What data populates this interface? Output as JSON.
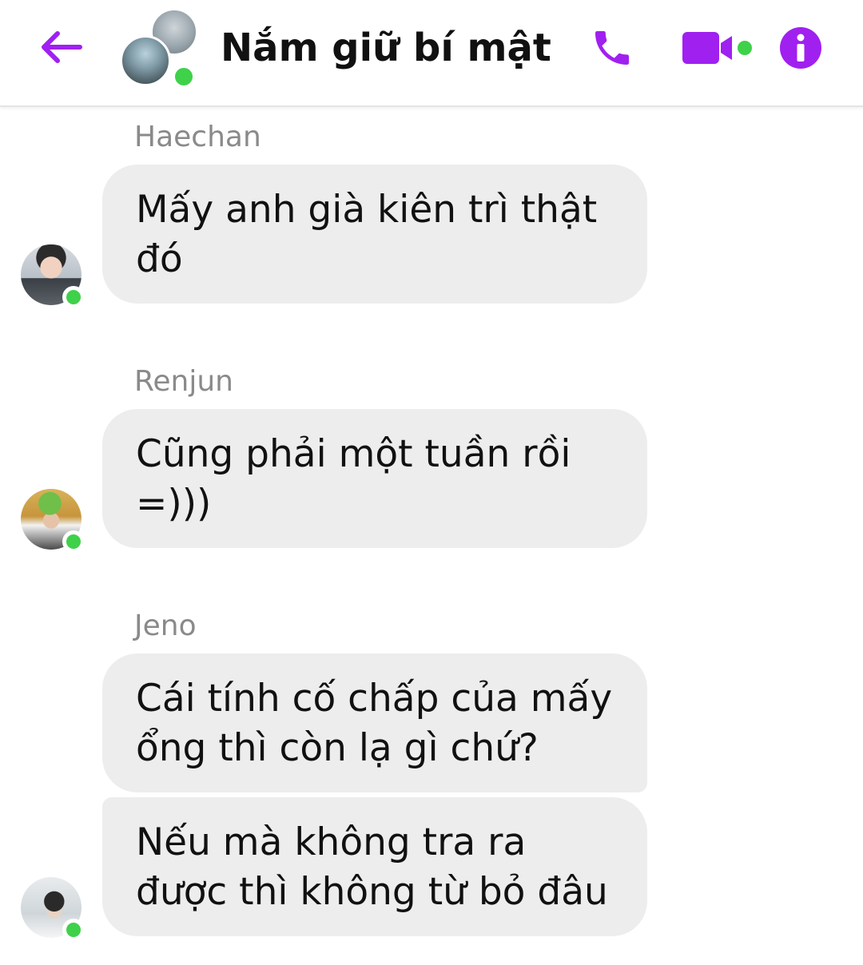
{
  "header": {
    "title": "Nắm giữ bí mật",
    "back_icon": "arrow-left-icon",
    "call_icon": "phone-icon",
    "video_icon": "video-camera-icon",
    "info_icon": "info-icon",
    "accent_color": "#a020f0",
    "online_color": "#3fd14a"
  },
  "messages": [
    {
      "sender": "Haechan",
      "bubbles": [
        {
          "lines": [
            "Mấy anh già kiên trì thật",
            "đó"
          ]
        }
      ]
    },
    {
      "sender": "Renjun",
      "bubbles": [
        {
          "lines": [
            "Cũng phải một tuần rồi",
            "=)))"
          ]
        }
      ]
    },
    {
      "sender": "Jeno",
      "bubbles": [
        {
          "lines": [
            "Cái tính cố chấp của mấy",
            "ổng thì còn lạ gì chứ?"
          ]
        },
        {
          "lines": [
            "Nếu mà không tra ra",
            "được thì không từ bỏ đâu"
          ]
        }
      ]
    }
  ]
}
